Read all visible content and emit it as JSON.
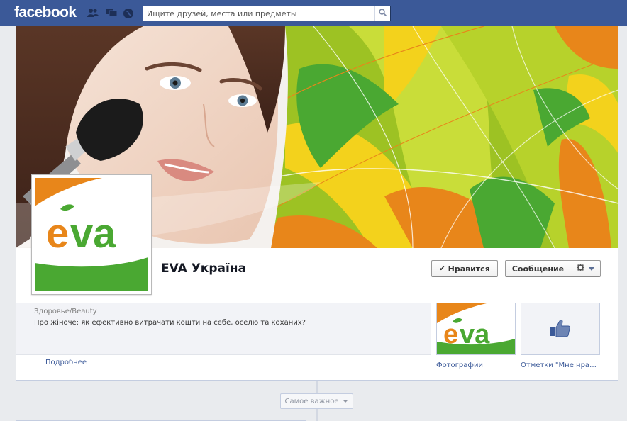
{
  "header": {
    "logo": "facebook",
    "search_placeholder": "Ищите друзей, места или предметы"
  },
  "page": {
    "name": "EVA Україна",
    "logo_text": "eva"
  },
  "actions": {
    "like_label": "Нравится",
    "message_label": "Сообщение"
  },
  "about": {
    "category": "Здоровье/Beauty",
    "description": "Про жіноче: як ефективно витрачати кошти на себе, оселю та коханих?",
    "more_link": "Подробнее"
  },
  "apps": [
    {
      "label": "Фотографии"
    },
    {
      "label": "Отметки \"Мне нрав…"
    }
  ],
  "timeline": {
    "sort_label": "Самое важное"
  },
  "colors": {
    "fb_blue": "#3b5998",
    "eva_orange": "#e8861a",
    "eva_green": "#4aa832",
    "cover_lime": "#9cc321",
    "cover_yellow": "#f3d21c"
  }
}
